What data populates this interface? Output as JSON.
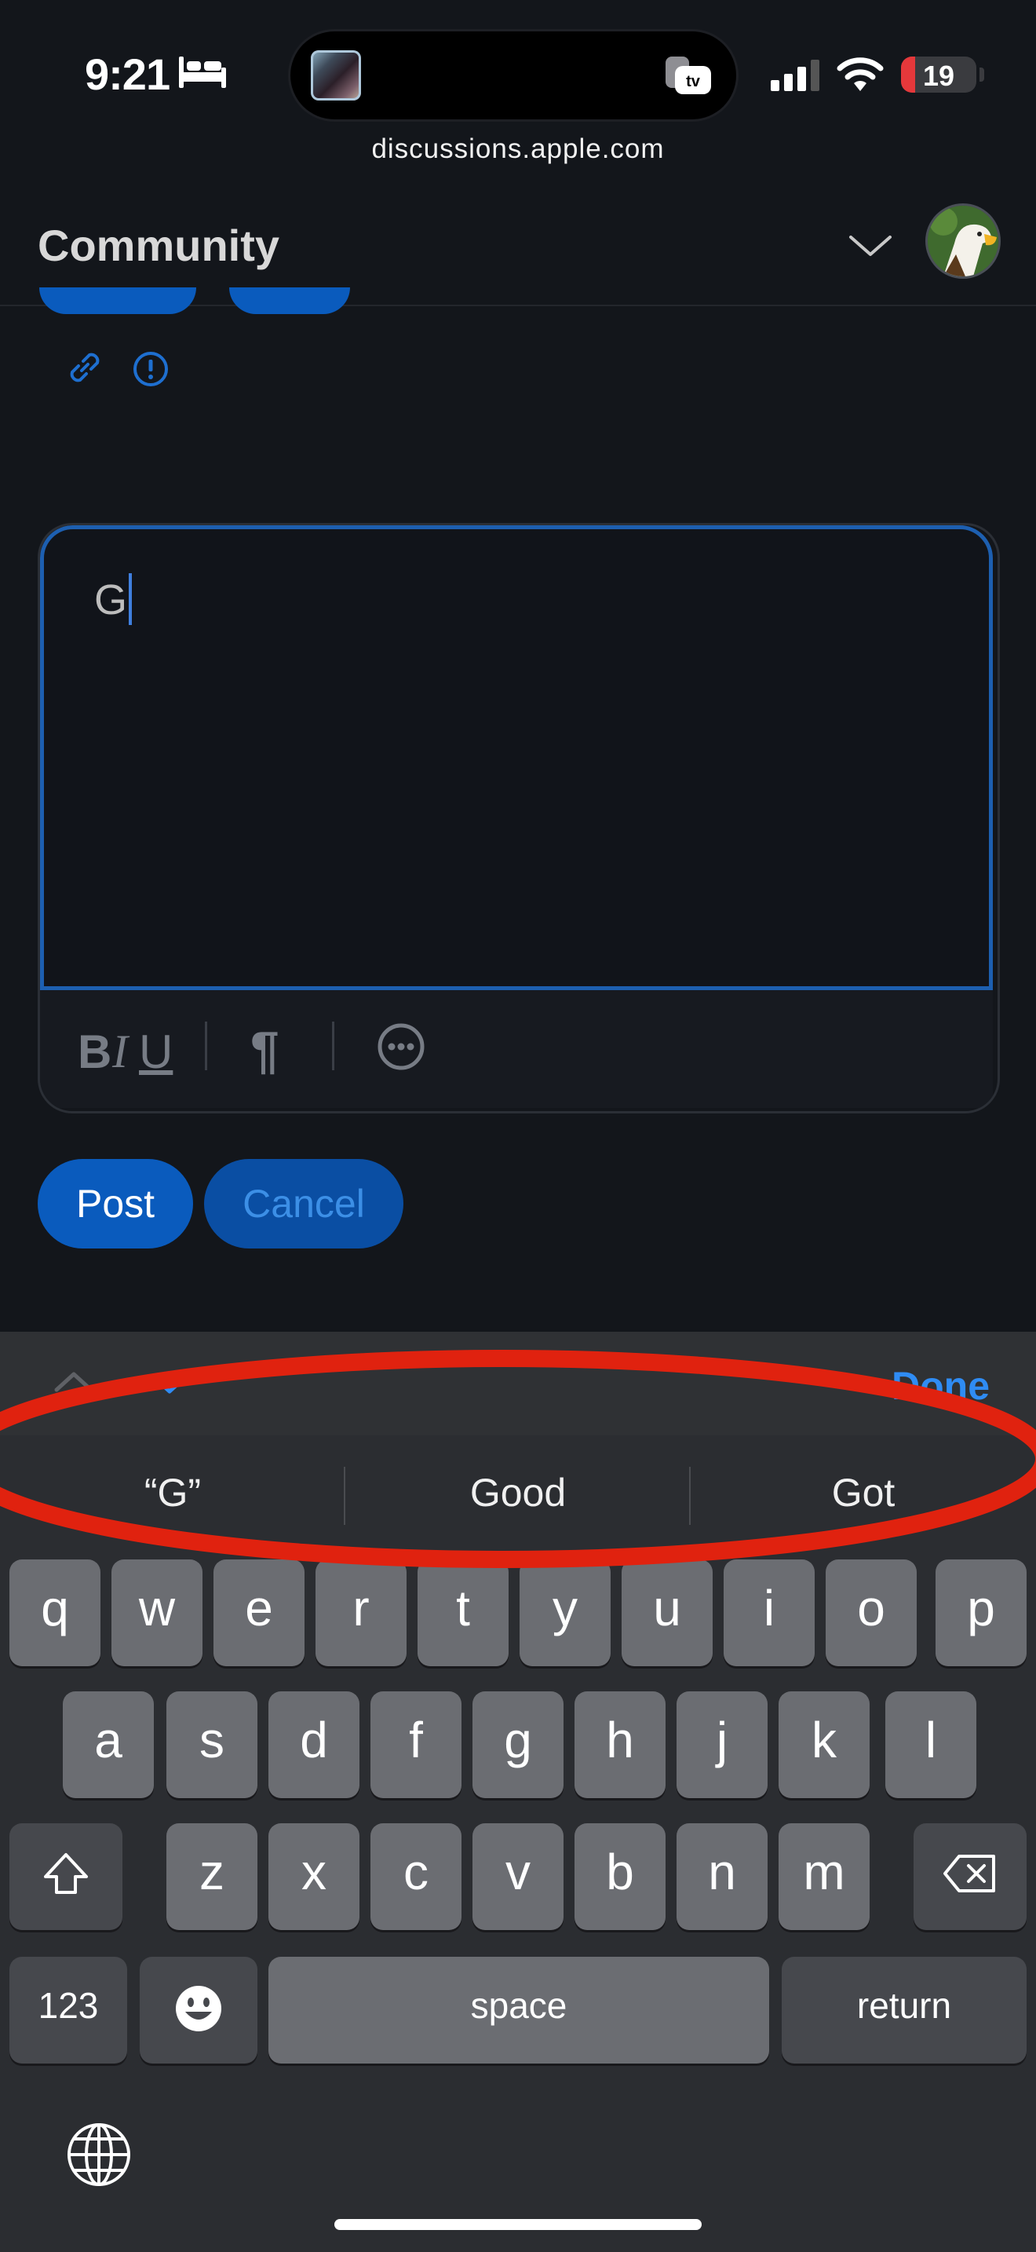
{
  "status_bar": {
    "time": "9:21",
    "battery_percent": "19",
    "battery_level": 0.19,
    "icons": [
      "bed-icon",
      "album-art",
      "apple-tv-icon",
      "cellular-signal-icon",
      "wifi-icon",
      "battery-icon"
    ]
  },
  "browser": {
    "url": "discussions.apple.com"
  },
  "header": {
    "title": "Community",
    "menu_icon": "chevron-down-icon",
    "avatar": "eagle-avatar"
  },
  "toolbar_icons": [
    "link-icon",
    "report-icon"
  ],
  "editor": {
    "text": "G",
    "formatting": {
      "bold": "B",
      "italic": "I",
      "underline": "U",
      "paragraph": "¶"
    },
    "more_icon": "ellipsis-circle-icon"
  },
  "actions": {
    "post_label": "Post",
    "cancel_label": "Cancel"
  },
  "keyboard": {
    "done_label": "Done",
    "suggestions": [
      "“G”",
      "Good",
      "Got"
    ],
    "rows": [
      [
        "q",
        "w",
        "e",
        "r",
        "t",
        "y",
        "u",
        "i",
        "o",
        "p"
      ],
      [
        "a",
        "s",
        "d",
        "f",
        "g",
        "h",
        "j",
        "k",
        "l"
      ],
      [
        "z",
        "x",
        "c",
        "v",
        "b",
        "n",
        "m"
      ]
    ],
    "numbers_label": "123",
    "space_label": "space",
    "return_label": "return"
  },
  "colors": {
    "background": "#13161b",
    "accent_blue": "#0a5bbd",
    "link_blue": "#2f8cf4",
    "annotation_red": "#e0220f"
  }
}
